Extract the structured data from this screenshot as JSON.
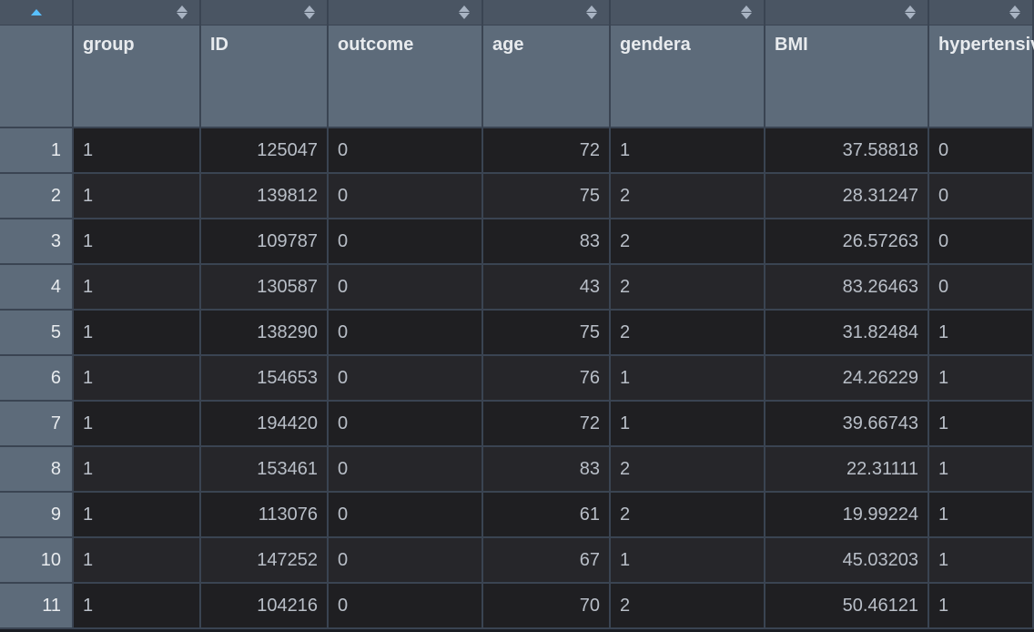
{
  "chart_data": {
    "type": "table",
    "columns": [
      "group",
      "ID",
      "outcome",
      "age",
      "gendera",
      "BMI",
      "hypertensive"
    ],
    "rows": [
      {
        "row": 1,
        "group": "1",
        "ID": "125047",
        "outcome": "0",
        "age": "72",
        "gendera": "1",
        "BMI": "37.58818",
        "hypertensive": "0"
      },
      {
        "row": 2,
        "group": "1",
        "ID": "139812",
        "outcome": "0",
        "age": "75",
        "gendera": "2",
        "BMI": "28.31247",
        "hypertensive": "0"
      },
      {
        "row": 3,
        "group": "1",
        "ID": "109787",
        "outcome": "0",
        "age": "83",
        "gendera": "2",
        "BMI": "26.57263",
        "hypertensive": "0"
      },
      {
        "row": 4,
        "group": "1",
        "ID": "130587",
        "outcome": "0",
        "age": "43",
        "gendera": "2",
        "BMI": "83.26463",
        "hypertensive": "0"
      },
      {
        "row": 5,
        "group": "1",
        "ID": "138290",
        "outcome": "0",
        "age": "75",
        "gendera": "2",
        "BMI": "31.82484",
        "hypertensive": "1"
      },
      {
        "row": 6,
        "group": "1",
        "ID": "154653",
        "outcome": "0",
        "age": "76",
        "gendera": "1",
        "BMI": "24.26229",
        "hypertensive": "1"
      },
      {
        "row": 7,
        "group": "1",
        "ID": "194420",
        "outcome": "0",
        "age": "72",
        "gendera": "1",
        "BMI": "39.66743",
        "hypertensive": "1"
      },
      {
        "row": 8,
        "group": "1",
        "ID": "153461",
        "outcome": "0",
        "age": "83",
        "gendera": "2",
        "BMI": "22.31111",
        "hypertensive": "1"
      },
      {
        "row": 9,
        "group": "1",
        "ID": "113076",
        "outcome": "0",
        "age": "61",
        "gendera": "2",
        "BMI": "19.99224",
        "hypertensive": "1"
      },
      {
        "row": 10,
        "group": "1",
        "ID": "147252",
        "outcome": "0",
        "age": "67",
        "gendera": "1",
        "BMI": "45.03203",
        "hypertensive": "1"
      },
      {
        "row": 11,
        "group": "1",
        "ID": "104216",
        "outcome": "0",
        "age": "70",
        "gendera": "2",
        "BMI": "50.46121",
        "hypertensive": "1"
      }
    ]
  },
  "headers": {
    "index": "",
    "group": "group",
    "ID": "ID",
    "outcome": "outcome",
    "age": "age",
    "gendera": "gendera",
    "BMI": "BMI",
    "hypertensive": "hypertensive"
  },
  "column_align": {
    "group": "left",
    "ID": "right",
    "outcome": "left",
    "age": "right",
    "gendera": "left",
    "BMI": "right",
    "hypertensive": "left"
  },
  "sort": {
    "column": "index",
    "direction": "asc"
  }
}
